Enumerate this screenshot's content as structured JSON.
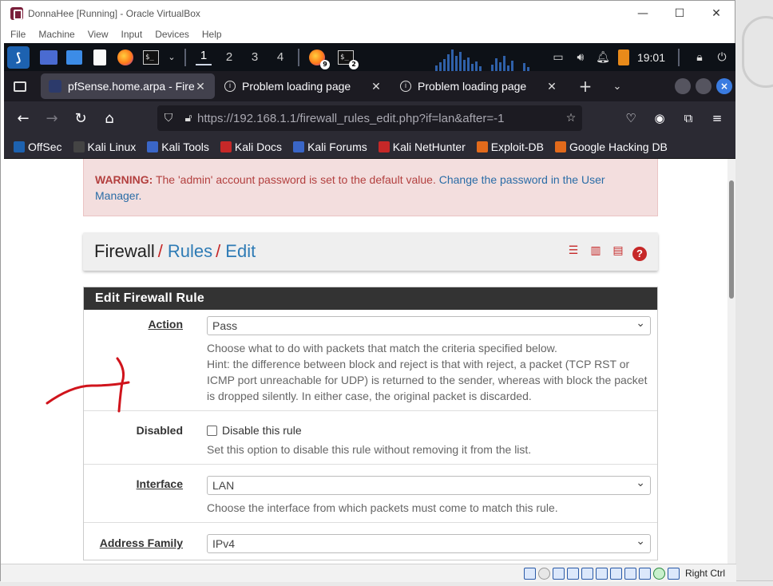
{
  "window": {
    "title": "DonnaHee [Running] - Oracle VirtualBox",
    "menu": [
      "File",
      "Machine",
      "View",
      "Input",
      "Devices",
      "Help"
    ],
    "minimize": "—",
    "maximize": "☐",
    "close": "✕"
  },
  "panel": {
    "workspaces": [
      "1",
      "2",
      "3",
      "4"
    ],
    "firefox_badge": "9",
    "terminal_badge": "2",
    "clock": "19:01",
    "terminal_prompt": "$_"
  },
  "tabs": [
    {
      "title": "pfSense.home.arpa - Firewall: Rules: Edit",
      "close": "✕"
    },
    {
      "title": "Problem loading page",
      "close": "✕"
    },
    {
      "title": "Problem loading page",
      "close": "✕"
    }
  ],
  "tabbar": {
    "new_tab": "+",
    "list_tabs": "⌄"
  },
  "navbar": {
    "url_host": "https://192.168.1.1",
    "url_path": "/firewall_rules_edit.php?if=lan&after=-1"
  },
  "bookmarks": [
    {
      "label": "OffSec",
      "color": "#1d62b0"
    },
    {
      "label": "Kali Linux",
      "color": "#444444"
    },
    {
      "label": "Kali Tools",
      "color": "#3a66c7"
    },
    {
      "label": "Kali Docs",
      "color": "#c62828"
    },
    {
      "label": "Kali Forums",
      "color": "#3a66c7"
    },
    {
      "label": "Kali NetHunter",
      "color": "#c62828"
    },
    {
      "label": "Exploit-DB",
      "color": "#e26a1b"
    },
    {
      "label": "Google Hacking DB",
      "color": "#e26a1b"
    }
  ],
  "warning": {
    "prefix": "WARNING:",
    "text": " The 'admin' account password is set to the default value. ",
    "link": "Change the password in the User Manager."
  },
  "breadcrumb": {
    "root": "Firewall",
    "sep": "/",
    "rules": "Rules",
    "edit": "Edit"
  },
  "form": {
    "title": "Edit Firewall Rule",
    "action": {
      "label": "Action",
      "value": "Pass",
      "help1": "Choose what to do with packets that match the criteria specified below.",
      "help2": "Hint: the difference between block and reject is that with reject, a packet (TCP RST or ICMP port unreachable for UDP) is returned to the sender, whereas with block the packet is dropped silently. In either case, the original packet is discarded."
    },
    "disabled": {
      "label": "Disabled",
      "checkbox_label": "Disable this rule",
      "help": "Set this option to disable this rule without removing it from the list."
    },
    "interface": {
      "label": "Interface",
      "value": "LAN",
      "help": "Choose the interface from which packets must come to match this rule."
    },
    "address_family": {
      "label": "Address Family",
      "value": "IPv4"
    }
  },
  "statusbar": {
    "host_key": "Right Ctrl"
  },
  "colors": {
    "accent_red": "#c62828",
    "link_blue": "#2e7bb5",
    "panel_dark": "#333333",
    "annotation": "#d0141c"
  }
}
